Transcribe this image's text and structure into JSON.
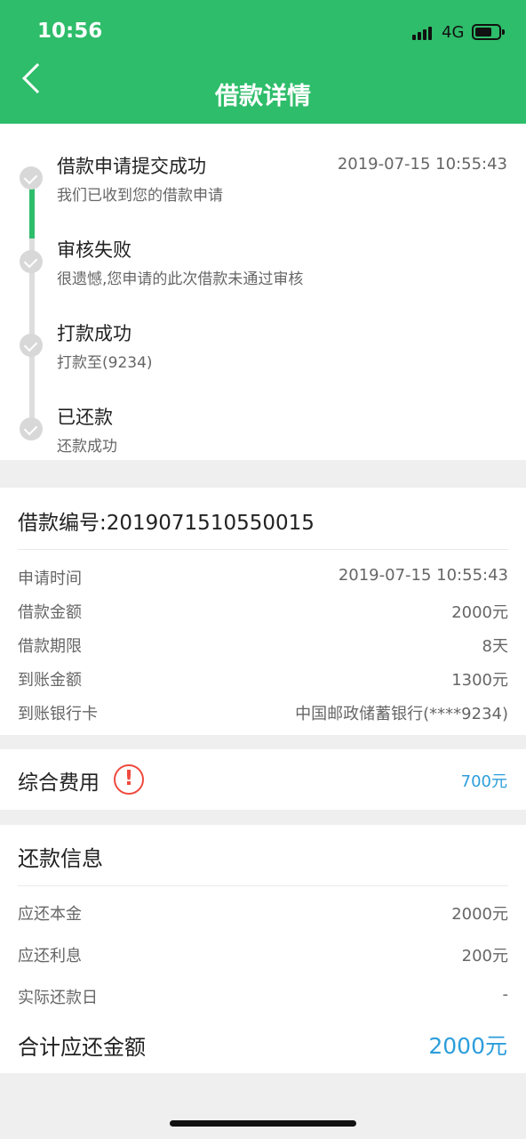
{
  "status_bar": {
    "time": "10:56",
    "network": "4G"
  },
  "nav": {
    "title": "借款详情"
  },
  "timeline": [
    {
      "title": "借款申请提交成功",
      "desc": "我们已收到您的借款申请",
      "time": "2019-07-15 10:55:43"
    },
    {
      "title": "审核失败",
      "desc": "很遗憾,您申请的此次借款未通过审核",
      "time": ""
    },
    {
      "title": "打款成功",
      "desc": "打款至(9234)",
      "time": ""
    },
    {
      "title": "已还款",
      "desc": "还款成功",
      "time": ""
    }
  ],
  "loan": {
    "number_label": "借款编号:2019071510550015",
    "rows": [
      {
        "label": "申请时间",
        "value": "2019-07-15 10:55:43"
      },
      {
        "label": "借款金额",
        "value": "2000元"
      },
      {
        "label": "借款期限",
        "value": "8天"
      },
      {
        "label": "到账金额",
        "value": "1300元"
      },
      {
        "label": "到账银行卡",
        "value": "中国邮政储蓄银行(****9234)"
      }
    ]
  },
  "fees": {
    "label": "综合费用",
    "icon": "!",
    "value": "700元"
  },
  "repayment": {
    "title": "还款信息",
    "rows": [
      {
        "label": "应还本金",
        "value": "2000元"
      },
      {
        "label": "应还利息",
        "value": "200元"
      },
      {
        "label": "实际还款日",
        "value": "-"
      }
    ],
    "total_label": "合计应还金额",
    "total_value": "2000元"
  },
  "colors": {
    "accent": "#2ebd6a",
    "link": "#2c9edb",
    "warning": "#ef4a3e"
  }
}
